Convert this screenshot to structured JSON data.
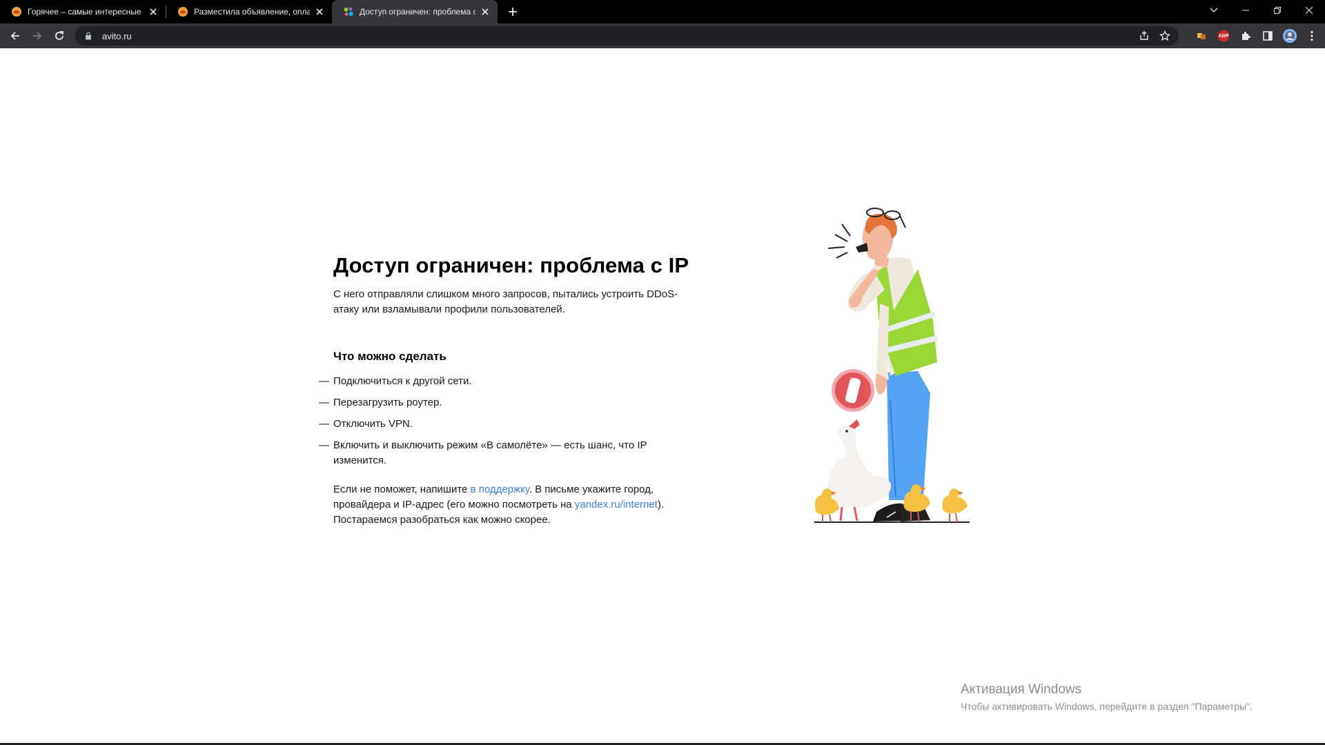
{
  "browser": {
    "tabs": [
      {
        "title": "Горячее – самые интересные и",
        "favicon": "pikabu-favicon",
        "active": false
      },
      {
        "title": "Разместила объявление, оплати",
        "favicon": "pikabu-favicon",
        "active": false
      },
      {
        "title": "Доступ ограничен: проблема с",
        "favicon": "avito-favicon",
        "active": true
      }
    ],
    "url": "avito.ru",
    "extensions": [
      "translate-extension-icon",
      "adblock-icon",
      "puzzle-extensions-icon",
      "side-panel-icon",
      "profile-avatar"
    ],
    "adblock_label": "ABP"
  },
  "page": {
    "title": "Доступ ограничен: проблема с IP",
    "lead": "С него отправляли слишком много запросов, пытались устроить DDoS-атаку или взламывали профили пользователей.",
    "what_to_do_heading": "Что можно сделать",
    "dash": "—",
    "steps": [
      "Подключиться к другой сети.",
      "Перезагрузить роутер.",
      "Отключить VPN.",
      "Включить и выключить режим «В самолёте» — есть шанс, что IP изменится."
    ],
    "footer": {
      "before_link": "Если не поможет, напишите ",
      "support_link": "в поддержку",
      "middle": ". В письме укажите город, провайдера и IP-адрес (его можно посмотреть на ",
      "yandex_link": "yandex.ru/internet",
      "after": "). Постараемся разобраться как можно скорее."
    }
  },
  "windows_activation": {
    "title": "Активация Windows",
    "subtitle": "Чтобы активировать Windows, перейдите в раздел \"Параметры\"."
  },
  "colors": {
    "link": "#3c80d9",
    "vest": "#9ad636",
    "pants": "#54a3f5",
    "hair": "#e5743c",
    "badge": "#e0565b",
    "duck": "#f6c142"
  }
}
